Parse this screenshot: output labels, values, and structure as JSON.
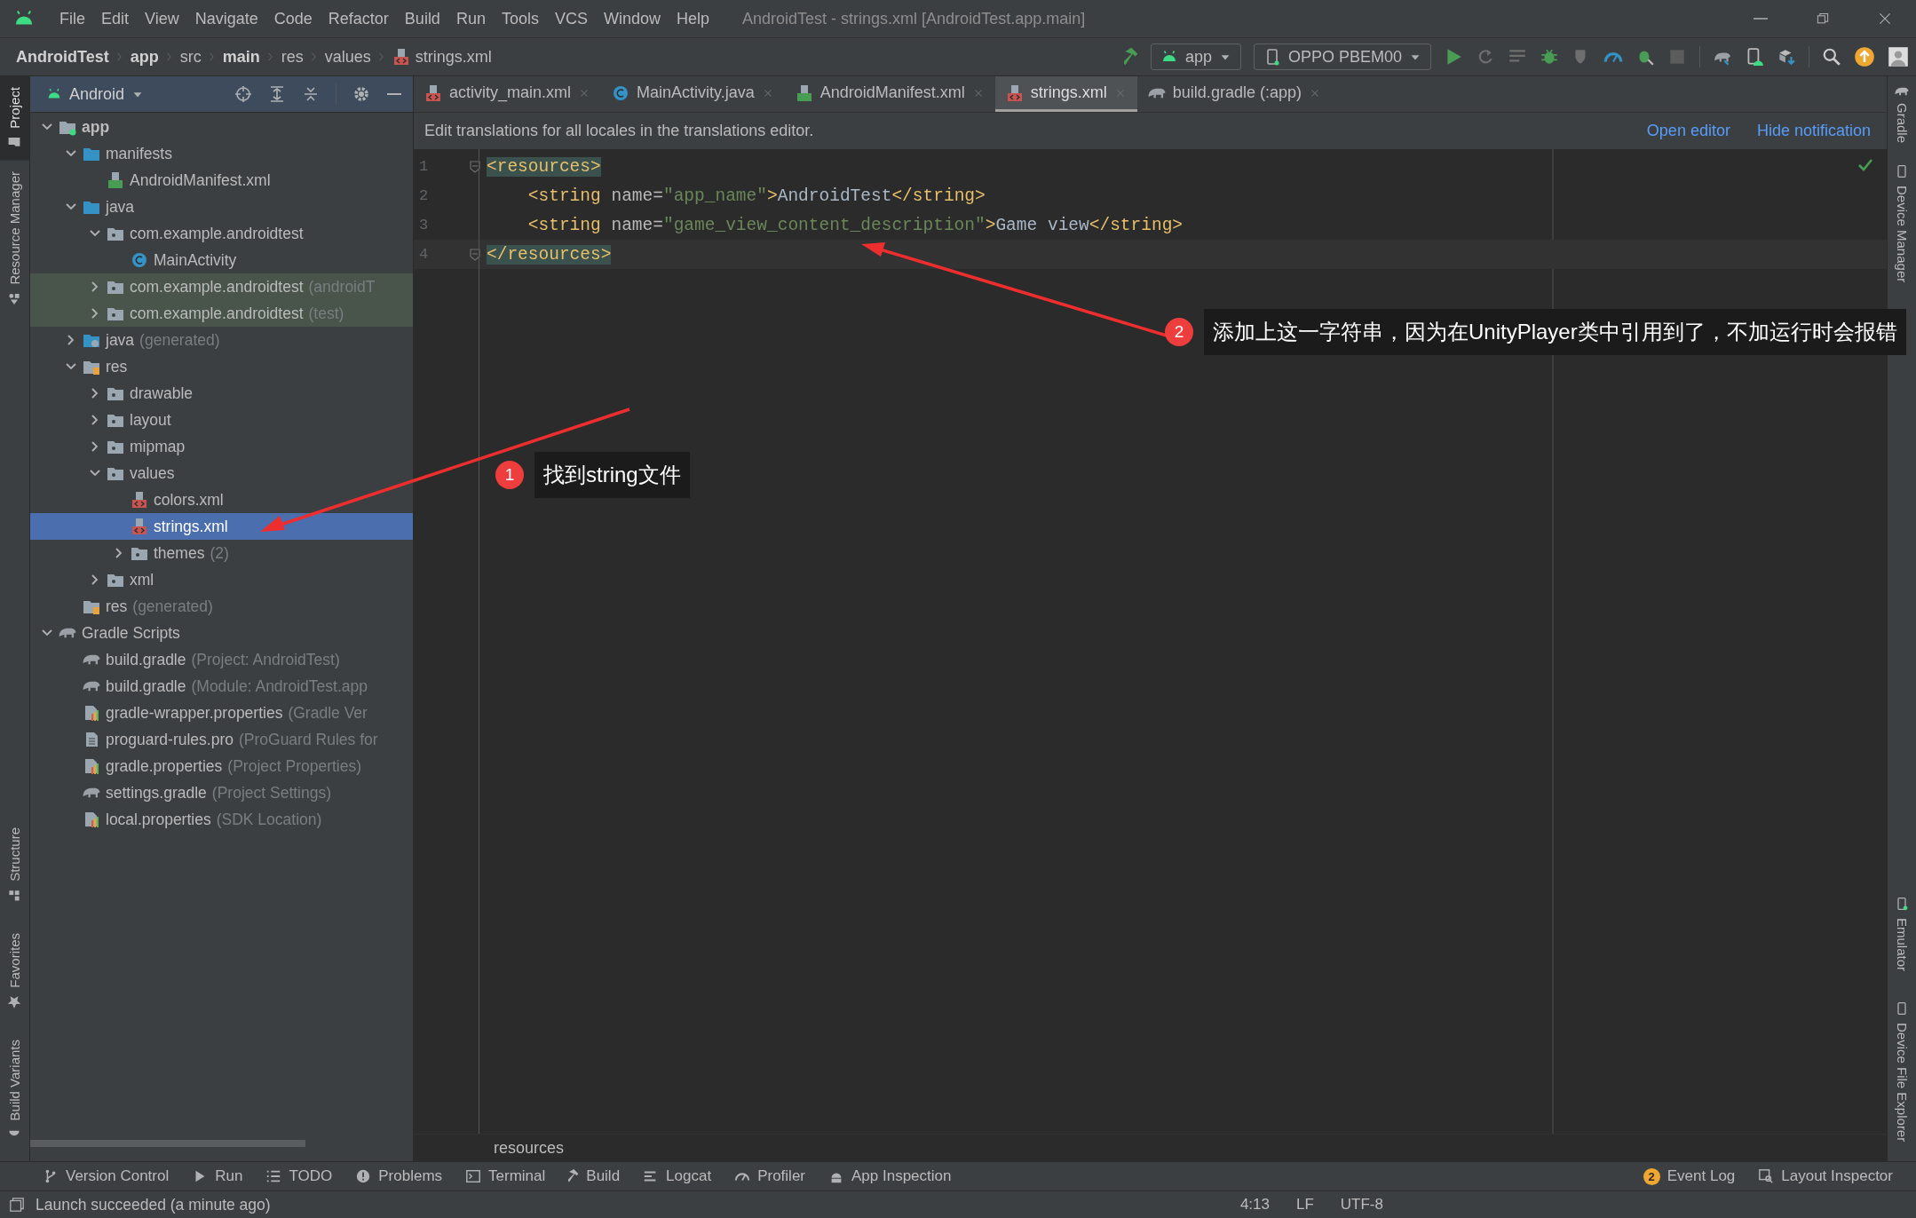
{
  "window": {
    "title": "AndroidTest - strings.xml [AndroidTest.app.main]",
    "menu": [
      "File",
      "Edit",
      "View",
      "Navigate",
      "Code",
      "Refactor",
      "Build",
      "Run",
      "Tools",
      "VCS",
      "Window",
      "Help"
    ]
  },
  "navigation_bar": {
    "breadcrumbs": [
      {
        "label": "AndroidTest",
        "bold": true,
        "kind": "segment"
      },
      {
        "label": "app",
        "bold": true,
        "kind": "segment"
      },
      {
        "label": "src",
        "bold": false,
        "kind": "segment"
      },
      {
        "label": "main",
        "bold": true,
        "kind": "segment"
      },
      {
        "label": "res",
        "bold": false,
        "kind": "segment"
      },
      {
        "label": "values",
        "bold": false,
        "kind": "segment"
      },
      {
        "label": "strings.xml",
        "bold": false,
        "kind": "file"
      }
    ],
    "run_configuration": "app",
    "device": "OPPO PBEM00"
  },
  "left_stripe": {
    "top": [
      {
        "label": "Project",
        "selected": true,
        "kind": "folder"
      },
      {
        "label": "Resource Manager",
        "selected": false,
        "kind": "shapes"
      }
    ],
    "bottom": [
      {
        "label": "Structure",
        "selected": false,
        "kind": "structure"
      },
      {
        "label": "Favorites",
        "selected": false,
        "kind": "star"
      },
      {
        "label": "Build Variants",
        "selected": false,
        "kind": "android"
      }
    ]
  },
  "project_panel": {
    "view": "Android",
    "tree": [
      {
        "name": "app",
        "kind": "module",
        "bold": true,
        "expanded": true,
        "selected": false,
        "children": [
          {
            "name": "manifests",
            "kind": "source-folder",
            "expanded": true,
            "selected": false,
            "children": [
              {
                "name": "AndroidManifest.xml",
                "kind": "manifest",
                "selected": false
              }
            ]
          },
          {
            "name": "java",
            "kind": "source-folder",
            "expanded": true,
            "selected": false,
            "children": [
              {
                "name": "com.example.androidtest",
                "kind": "package",
                "expanded": true,
                "selected": false,
                "children": [
                  {
                    "name": "MainActivity",
                    "kind": "class",
                    "selected": false
                  }
                ]
              },
              {
                "name": "com.example.androidtest",
                "suffix": "(androidT",
                "kind": "package",
                "expanded": false,
                "selected": false,
                "highlighted": true
              },
              {
                "name": "com.example.androidtest",
                "suffix": "(test)",
                "kind": "package",
                "expanded": false,
                "selected": false,
                "highlighted": true
              }
            ]
          },
          {
            "name": "java",
            "suffix": "(generated)",
            "kind": "generated-folder",
            "expanded": false,
            "selected": false
          },
          {
            "name": "res",
            "kind": "res-folder",
            "expanded": true,
            "selected": false,
            "children": [
              {
                "name": "drawable",
                "kind": "package",
                "expanded": false,
                "selected": false
              },
              {
                "name": "layout",
                "kind": "package",
                "expanded": false,
                "selected": false
              },
              {
                "name": "mipmap",
                "kind": "package",
                "expanded": false,
                "selected": false
              },
              {
                "name": "values",
                "kind": "package",
                "expanded": true,
                "selected": false,
                "children": [
                  {
                    "name": "colors.xml",
                    "kind": "xml",
                    "selected": false
                  },
                  {
                    "name": "strings.xml",
                    "kind": "xml",
                    "selected": true
                  },
                  {
                    "name": "themes",
                    "suffix": "(2)",
                    "kind": "package",
                    "expanded": false,
                    "selected": false
                  }
                ]
              },
              {
                "name": "xml",
                "kind": "package",
                "expanded": false,
                "selected": false
              }
            ]
          },
          {
            "name": "res",
            "suffix": "(generated)",
            "kind": "res-folder",
            "selected": false
          }
        ]
      },
      {
        "name": "Gradle Scripts",
        "kind": "gradle",
        "expanded": true,
        "selected": false,
        "children": [
          {
            "name": "build.gradle",
            "suffix": "(Project: AndroidTest)",
            "kind": "gradle",
            "selected": false
          },
          {
            "name": "build.gradle",
            "suffix": "(Module: AndroidTest.app",
            "kind": "gradle",
            "selected": false
          },
          {
            "name": "gradle-wrapper.properties",
            "suffix": "(Gradle Ver",
            "kind": "properties",
            "selected": false
          },
          {
            "name": "proguard-rules.pro",
            "suffix": "(ProGuard Rules for",
            "kind": "text",
            "selected": false
          },
          {
            "name": "gradle.properties",
            "suffix": "(Project Properties)",
            "kind": "properties",
            "selected": false
          },
          {
            "name": "settings.gradle",
            "suffix": "(Project Settings)",
            "kind": "gradle",
            "selected": false
          },
          {
            "name": "local.properties",
            "suffix": "(SDK Location)",
            "kind": "properties",
            "selected": false
          }
        ]
      }
    ]
  },
  "editor_tabs": [
    {
      "label": "activity_main.xml",
      "kind": "xml",
      "selected": false
    },
    {
      "label": "MainActivity.java",
      "kind": "class",
      "selected": false
    },
    {
      "label": "AndroidManifest.xml",
      "kind": "manifest",
      "selected": false
    },
    {
      "label": "strings.xml",
      "kind": "xml",
      "selected": true
    },
    {
      "label": "build.gradle (:app)",
      "kind": "gradle",
      "selected": false
    }
  ],
  "notification": {
    "text": "Edit translations for all locales in the translations editor.",
    "actions": [
      "Open editor",
      "Hide notification"
    ]
  },
  "editor": {
    "lines": [
      {
        "number": "1",
        "fold": true,
        "current": false,
        "parts": [
          {
            "kind": "tag",
            "text": "<resources>",
            "matched": true
          }
        ]
      },
      {
        "number": "2",
        "fold": false,
        "current": false,
        "parts": [
          {
            "kind": "tag",
            "text": "    <string "
          },
          {
            "kind": "attr",
            "text": "name="
          },
          {
            "kind": "value",
            "text": "\"app_name\""
          },
          {
            "kind": "tag",
            "text": ">"
          },
          {
            "kind": "text",
            "text": "AndroidTest"
          },
          {
            "kind": "tag",
            "text": "</string>"
          }
        ]
      },
      {
        "number": "3",
        "fold": false,
        "current": false,
        "parts": [
          {
            "kind": "tag",
            "text": "    <string "
          },
          {
            "kind": "attr",
            "text": "name="
          },
          {
            "kind": "value",
            "text": "\"game_view_content_description\""
          },
          {
            "kind": "tag",
            "text": ">"
          },
          {
            "kind": "text",
            "text": "Game view"
          },
          {
            "kind": "tag",
            "text": "</string>"
          }
        ]
      },
      {
        "number": "4",
        "fold": true,
        "current": true,
        "parts": [
          {
            "kind": "tag",
            "text": "</resources>",
            "matched": true
          }
        ]
      }
    ],
    "breadcrumb": "resources"
  },
  "annotations": [
    {
      "number": "1",
      "text": "找到string文件"
    },
    {
      "number": "2",
      "text": "添加上这一字符串，因为在UnityPlayer类中引用到了，不加运行时会报错"
    }
  ],
  "right_stripe": {
    "top": [
      {
        "label": "Gradle",
        "kind": "gradle"
      },
      {
        "label": "Device Manager",
        "kind": "device"
      }
    ],
    "bottom": [
      {
        "label": "Emulator",
        "kind": "emulator"
      },
      {
        "label": "Device File Explorer",
        "kind": "device"
      }
    ]
  },
  "tool_windows": {
    "left": [
      {
        "label": "Version Control",
        "kind": "vcs"
      },
      {
        "label": "Run",
        "kind": "run"
      },
      {
        "label": "TODO",
        "kind": "list"
      },
      {
        "label": "Problems",
        "kind": "problems"
      },
      {
        "label": "Terminal",
        "kind": "terminal"
      },
      {
        "label": "Build",
        "kind": "build"
      },
      {
        "label": "Logcat",
        "kind": "logcat"
      },
      {
        "label": "Profiler",
        "kind": "profiler"
      },
      {
        "label": "App Inspection",
        "kind": "inspection"
      }
    ],
    "right": [
      {
        "label": "Event Log",
        "kind": "event",
        "badge": "2"
      },
      {
        "label": "Layout Inspector",
        "kind": "inspector"
      }
    ]
  },
  "status_bar": {
    "message": "Launch succeeded (a minute ago)",
    "items": [
      "4:13",
      "LF",
      "UTF-8"
    ]
  }
}
